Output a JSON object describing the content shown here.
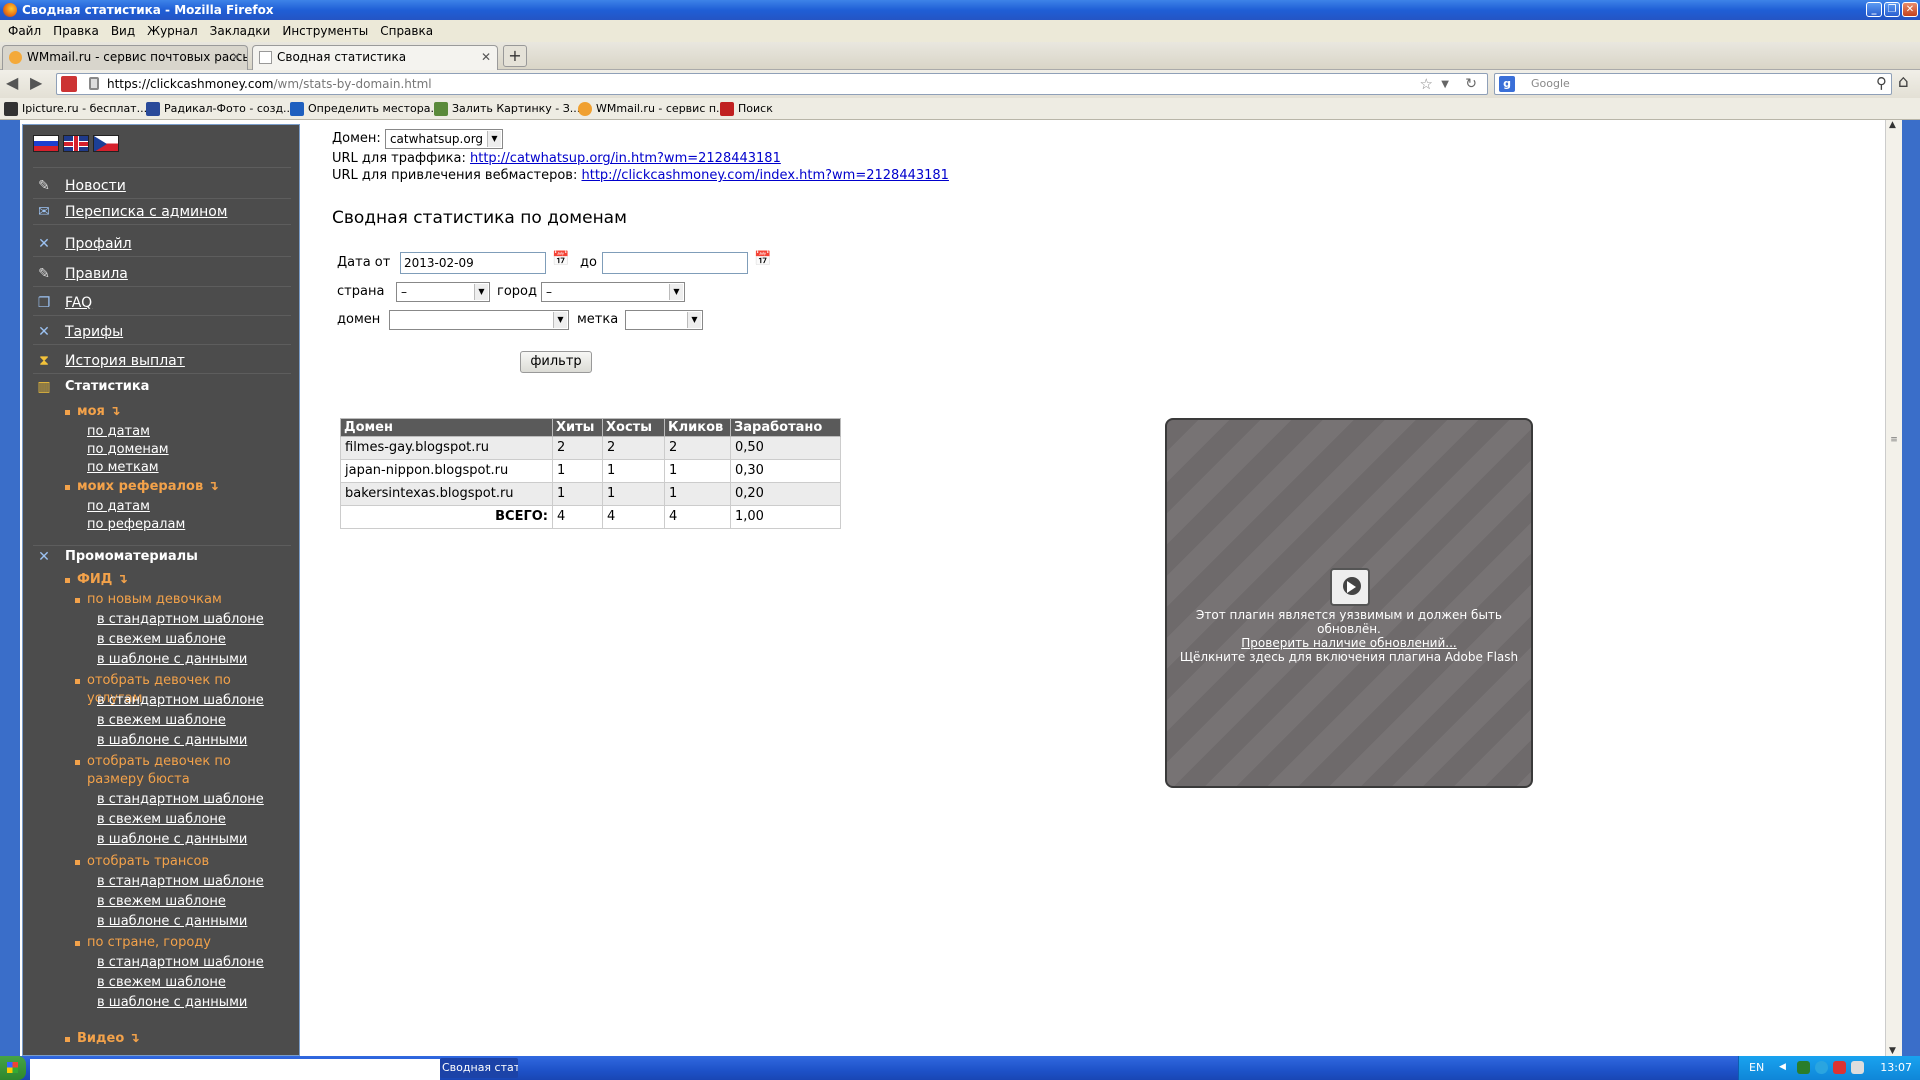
{
  "window": {
    "title": "Сводная статистика - Mozilla Firefox"
  },
  "menu": [
    "Файл",
    "Правка",
    "Вид",
    "Журнал",
    "Закладки",
    "Инструменты",
    "Справка"
  ],
  "tabs": [
    {
      "label": "WMmail.ru - сервис почтовых рассылок...",
      "active": false
    },
    {
      "label": "Сводная статистика",
      "active": true
    }
  ],
  "address": {
    "host": "https://clickcashmoney.com",
    "path": "/wm/stats-by-domain.html"
  },
  "search": {
    "placeholder": "Google"
  },
  "bookmarks": [
    {
      "label": "Ipicture.ru - бесплат...",
      "color": "#333333"
    },
    {
      "label": "Радикал-Фото - созд...",
      "color": "#2a4a9a"
    },
    {
      "label": "Определить местора...",
      "color": "#1e5fbf"
    },
    {
      "label": "Залить Картинку - З...",
      "color": "#5a8a3a"
    },
    {
      "label": "WMmail.ru - сервис п...",
      "color": "#f0a030"
    },
    {
      "label": "Поиск",
      "color": "#c02020"
    }
  ],
  "sidebar": {
    "items": [
      {
        "label": "Новости",
        "icon": "news-icon",
        "glyph": "✎"
      },
      {
        "label": "Переписка с админом",
        "icon": "mail-icon",
        "glyph": "✉"
      },
      {
        "label": "Профайл",
        "icon": "tools-icon",
        "glyph": "✕"
      },
      {
        "label": "Правила",
        "icon": "rules-icon",
        "glyph": "✎"
      },
      {
        "label": "FAQ",
        "icon": "faq-icon",
        "glyph": "❐"
      },
      {
        "label": "Тарифы",
        "icon": "tools-icon",
        "glyph": "✕"
      },
      {
        "label": "История выплат",
        "icon": "hourglass-icon",
        "glyph": "⧗"
      }
    ],
    "stats_heading": "Статистика",
    "my_label": "моя",
    "my_links": [
      "по датам",
      "по доменам",
      "по меткам"
    ],
    "referrals_label": "моих рефералов",
    "referrals_links": [
      "по датам",
      "по рефералам"
    ],
    "promo_heading": "Промоматериалы",
    "feed_label": "ФИД",
    "feed_groups": [
      {
        "label": "по новым девочкам",
        "links": [
          "в стандартном шаблоне",
          "в свежем шаблоне",
          "в шаблоне с данными"
        ]
      },
      {
        "label": "отобрать девочек по услугам",
        "links": [
          "в стандартном шаблоне",
          "в свежем шаблоне",
          "в шаблоне с данными"
        ]
      },
      {
        "label": "отобрать девочек по размеру бюста",
        "links": [
          "в стандартном шаблоне",
          "в свежем шаблоне",
          "в шаблоне с данными"
        ]
      },
      {
        "label": "отобрать трансов",
        "links": [
          "в стандартном шаблоне",
          "в свежем шаблоне",
          "в шаблоне с данными"
        ]
      },
      {
        "label": "по стране, городу",
        "links": [
          "в стандартном шаблоне",
          "в свежем шаблоне",
          "в шаблоне с данными"
        ]
      }
    ],
    "video_label": "Видео",
    "arrow": "↴"
  },
  "main": {
    "domain_label": "Домен:",
    "domain_value": "catwhatsup.org",
    "traffic_url_label": "URL для траффика:",
    "traffic_url": "http://catwhatsup.org/in.htm?wm=2128443181",
    "webmasters_url_label": "URL для привлечения вебмастеров:",
    "webmasters_url": "http://clickcashmoney.com/index.htm?wm=2128443181",
    "title": "Сводная статистика по доменам",
    "filter": {
      "date_from_label": "Дата от",
      "date_from": "2013-02-09",
      "date_to_label": "до",
      "date_to": "",
      "country_label": "страна",
      "country_value": "–",
      "city_label": "город",
      "city_value": "–",
      "domain_label": "домен",
      "domain_value": "",
      "tag_label": "метка",
      "tag_value": "",
      "button": "фильтр"
    },
    "table": {
      "headers": [
        "Домен",
        "Хиты",
        "Хосты",
        "Кликов",
        "Заработано"
      ],
      "rows": [
        [
          "filmes-gay.blogspot.ru",
          "2",
          "2",
          "2",
          "0,50"
        ],
        [
          "japan-nippon.blogspot.ru",
          "1",
          "1",
          "1",
          "0,30"
        ],
        [
          "bakersintexas.blogspot.ru",
          "1",
          "1",
          "1",
          "0,20"
        ]
      ],
      "total": [
        "ВСЕГО:",
        "4",
        "4",
        "4",
        "1,00"
      ]
    },
    "plugin": {
      "line1": "Этот плагин является уязвимым и должен быть обновлён.",
      "link": "Проверить наличие обновлений...",
      "line2": "Щёлкните здесь для включения плагина Adobe Flash"
    }
  },
  "taskbar": {
    "item": "Сводная статистик...",
    "lang": "EN",
    "clock": "13:07"
  }
}
